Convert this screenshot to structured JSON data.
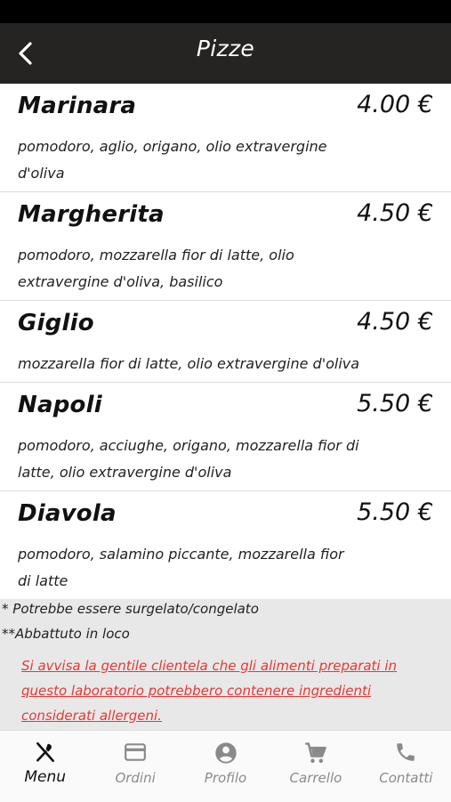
{
  "header": {
    "title": "Pizze"
  },
  "pizzas": [
    {
      "name": "Marinara",
      "price": "4.00 €",
      "description": "pomodoro, aglio, origano, olio extravergine d'oliva"
    },
    {
      "name": "Margherita",
      "price": "4.50 €",
      "description": "pomodoro, mozzarella fior di latte, olio extravergine d'oliva, basilico"
    },
    {
      "name": "Giglio",
      "price": "4.50 €",
      "description": "mozzarella fior di latte, olio extravergine d'oliva"
    },
    {
      "name": "Napoli",
      "price": "5.50 €",
      "description": "pomodoro, acciughe, origano, mozzarella fior di latte, olio extravergine d'oliva"
    },
    {
      "name": "Diavola",
      "price": "5.50 €",
      "description": "pomodoro, salamino piccante, mozzarella fior di latte"
    }
  ],
  "notes": {
    "frozen": "* Potrebbe essere surgelato/congelato",
    "slaughtered": "**Abbattuto in loco",
    "allergen_warning": "Si avvisa la gentile clientela che gli alimenti preparati in questo laboratorio potrebbero contenere ingredienti considerati allergeni."
  },
  "nav": {
    "menu": "Menu",
    "orders": "Ordini",
    "profile": "Profilo",
    "cart": "Carrello",
    "contacts": "Contatti"
  },
  "icons": {
    "back": "chevron-left-icon",
    "menu": "fork-knife-icon",
    "orders": "credit-card-icon",
    "profile": "account-circle-icon",
    "cart": "cart-icon",
    "contacts": "phone-icon"
  },
  "colors": {
    "appbar": "#252423",
    "warning": "#e53935",
    "nav_inactive": "#8a8a8a"
  }
}
